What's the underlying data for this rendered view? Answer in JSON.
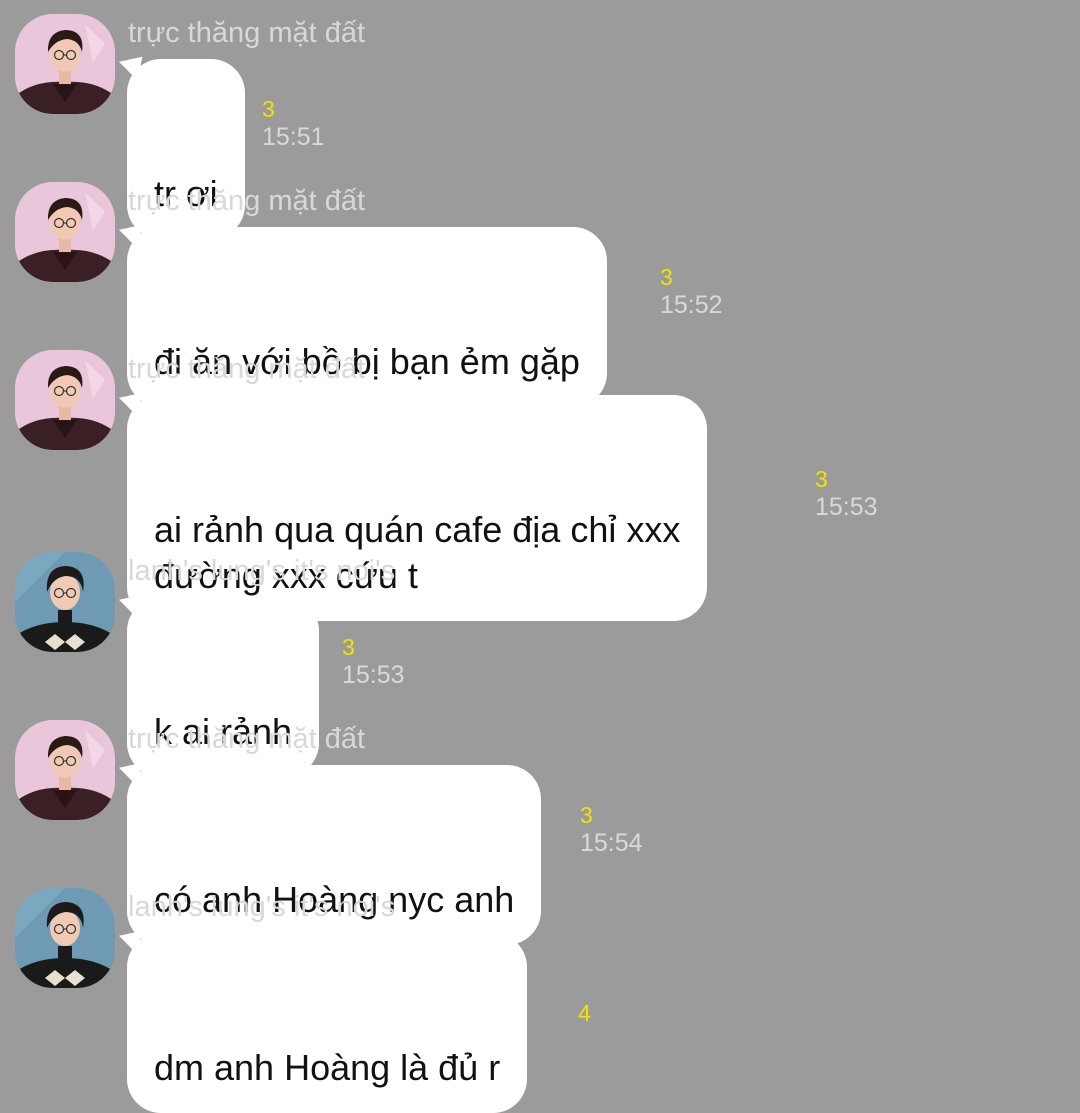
{
  "colors": {
    "background": "#9b9b9b",
    "bubble": "#ffffff",
    "sender_name": "#d8d8d8",
    "unread_count": "#f2e300",
    "timestamp": "#d9d9d9"
  },
  "messages": [
    {
      "sender": "trực thăng mặt đất",
      "avatar": "avatar-truc-thang",
      "text": "tr ơi",
      "unread": "3",
      "time": "15:51"
    },
    {
      "sender": "trực thăng mặt đất",
      "avatar": "avatar-truc-thang",
      "text": "đi ăn với bồ bị bạn ẻm gặp",
      "unread": "3",
      "time": "15:52"
    },
    {
      "sender": "trực thăng mặt đất",
      "avatar": "avatar-truc-thang",
      "text": "ai rảnh qua quán cafe địa chỉ xxx\nđường xxx cứu t",
      "unread": "3",
      "time": "15:53"
    },
    {
      "sender": "lanh's lung's it's noi's",
      "avatar": "avatar-lanh-lung",
      "text": "k ai rảnh",
      "unread": "3",
      "time": "15:53"
    },
    {
      "sender": "trực thăng mặt đất",
      "avatar": "avatar-truc-thang",
      "text": "có anh Hoàng nyc anh",
      "unread": "3",
      "time": "15:54"
    },
    {
      "sender": "lanh's lung's it's noi's",
      "avatar": "avatar-lanh-lung",
      "text": "dm anh Hoàng là đủ r",
      "unread": "4",
      "time": ""
    }
  ]
}
